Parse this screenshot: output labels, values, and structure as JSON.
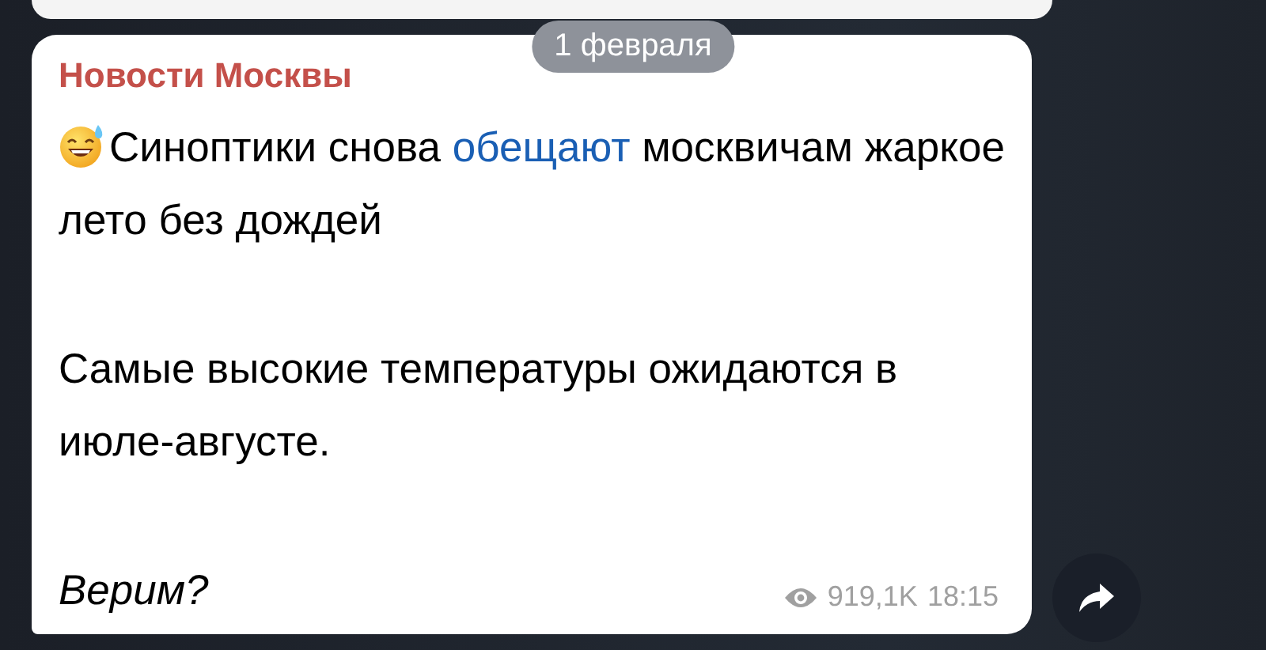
{
  "date_pill": "1 февраля",
  "message": {
    "sender": "Новости Москвы",
    "paragraphs": [
      {
        "kind": "emoji",
        "parts": [
          {
            "kind": "plain",
            "text": "Синоптики снова "
          },
          {
            "kind": "link",
            "text": "обещают"
          },
          {
            "kind": "plain",
            "text": " москвичам жаркое лето без дождей"
          }
        ]
      },
      {
        "kind": "plain",
        "parts": [
          {
            "kind": "plain",
            "text": "Самые высокие температуры ожидаются в июле-августе."
          }
        ]
      },
      {
        "kind": "italic",
        "parts": [
          {
            "kind": "plain",
            "text": "Верим?"
          }
        ]
      }
    ],
    "views": "919,1K",
    "time": "18:15"
  }
}
